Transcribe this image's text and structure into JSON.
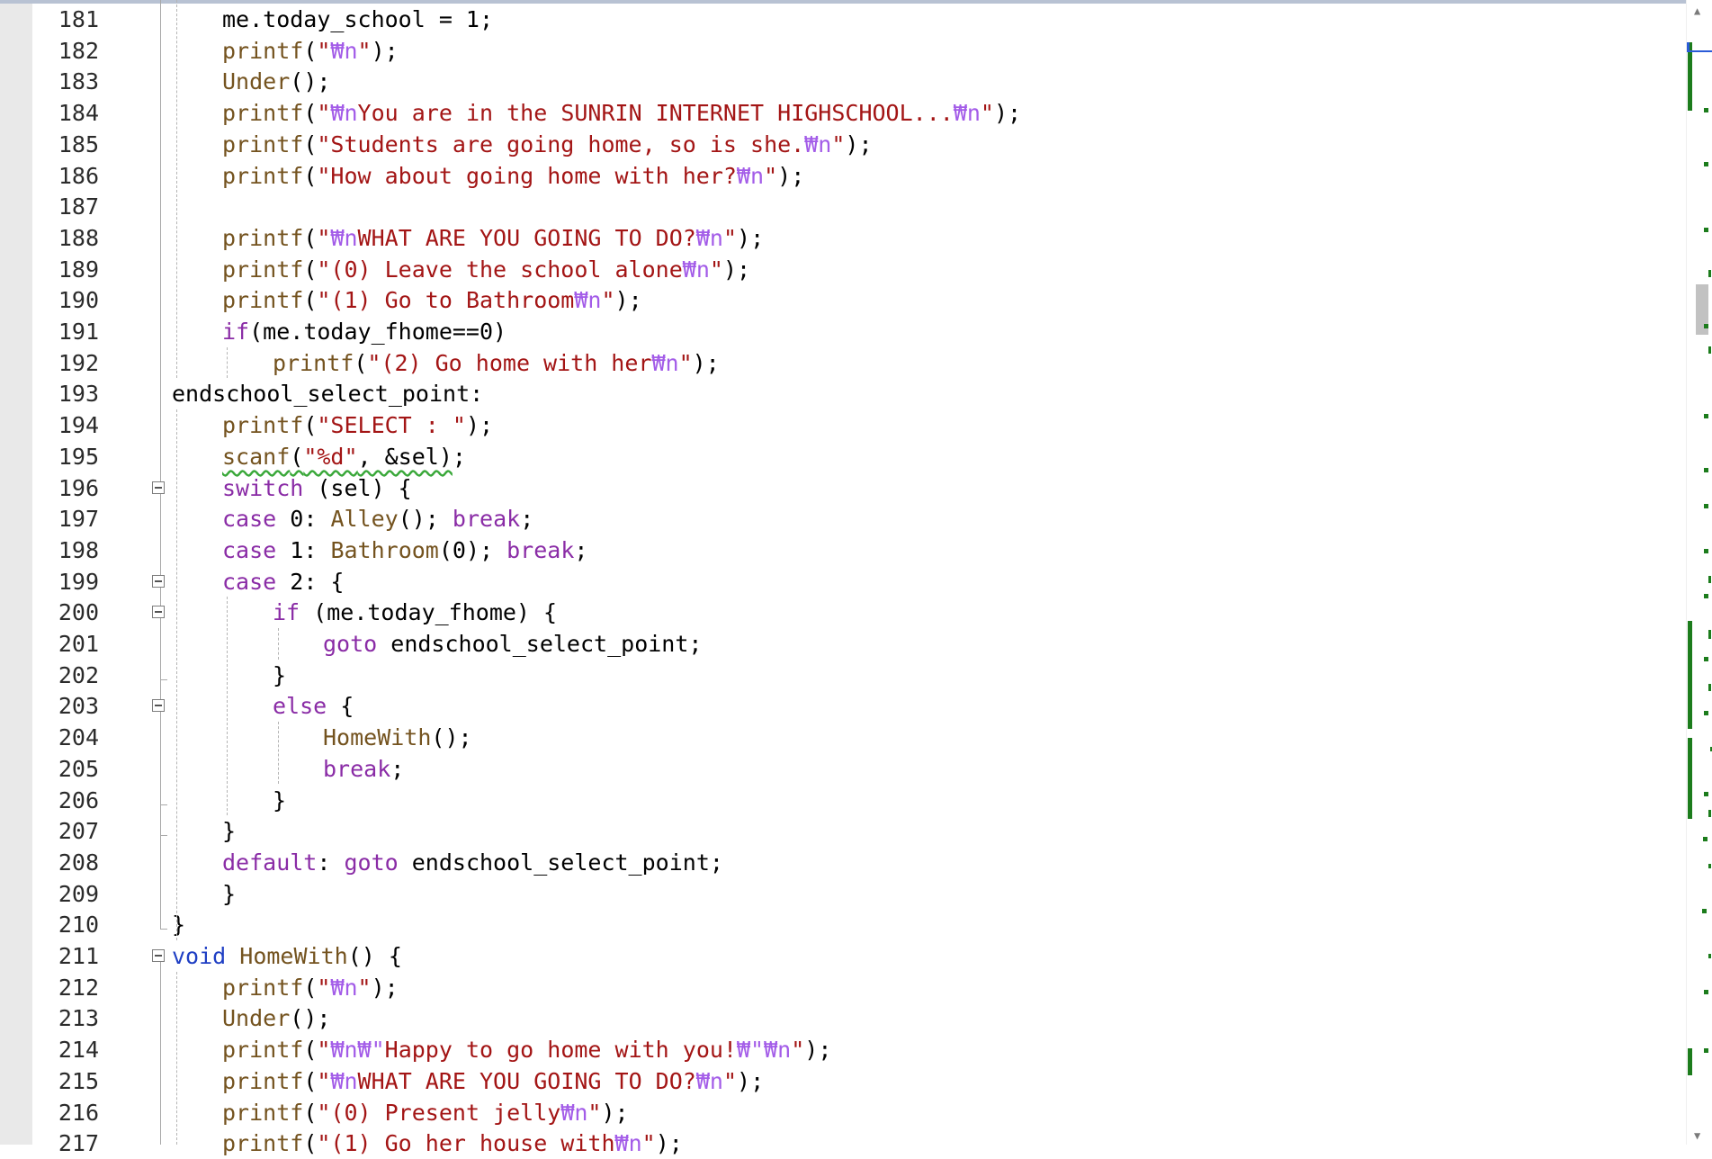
{
  "editor": {
    "lines": [
      {
        "n": "181",
        "indent": 1,
        "t": [
          [
            "",
            "me.today_school = 1;"
          ]
        ]
      },
      {
        "n": "182",
        "indent": 1,
        "t": [
          [
            "f",
            "printf"
          ],
          [
            "",
            "("
          ],
          [
            "s",
            "\""
          ],
          [
            "e",
            "₩n"
          ],
          [
            "s",
            "\""
          ],
          [
            "",
            ");"
          ]
        ]
      },
      {
        "n": "183",
        "indent": 1,
        "t": [
          [
            "f",
            "Under"
          ],
          [
            "",
            "();"
          ]
        ]
      },
      {
        "n": "184",
        "indent": 1,
        "t": [
          [
            "f",
            "printf"
          ],
          [
            "",
            "("
          ],
          [
            "s",
            "\""
          ],
          [
            "e",
            "₩n"
          ],
          [
            "s",
            "You are in the SUNRIN INTERNET HIGHSCHOOL..."
          ],
          [
            "e",
            "₩n"
          ],
          [
            "s",
            "\""
          ],
          [
            "",
            ");"
          ]
        ]
      },
      {
        "n": "185",
        "indent": 1,
        "t": [
          [
            "f",
            "printf"
          ],
          [
            "",
            "("
          ],
          [
            "s",
            "\"Students are going home, so is she."
          ],
          [
            "e",
            "₩n"
          ],
          [
            "s",
            "\""
          ],
          [
            "",
            ");"
          ]
        ]
      },
      {
        "n": "186",
        "indent": 1,
        "t": [
          [
            "f",
            "printf"
          ],
          [
            "",
            "("
          ],
          [
            "s",
            "\"How about going home with her?"
          ],
          [
            "e",
            "₩n"
          ],
          [
            "s",
            "\""
          ],
          [
            "",
            ");"
          ]
        ]
      },
      {
        "n": "187",
        "indent": 0,
        "t": []
      },
      {
        "n": "188",
        "indent": 1,
        "t": [
          [
            "f",
            "printf"
          ],
          [
            "",
            "("
          ],
          [
            "s",
            "\""
          ],
          [
            "e",
            "₩n"
          ],
          [
            "s",
            "WHAT ARE YOU GOING TO DO?"
          ],
          [
            "e",
            "₩n"
          ],
          [
            "s",
            "\""
          ],
          [
            "",
            ");"
          ]
        ]
      },
      {
        "n": "189",
        "indent": 1,
        "t": [
          [
            "f",
            "printf"
          ],
          [
            "",
            "("
          ],
          [
            "s",
            "\"(0) Leave the school alone"
          ],
          [
            "e",
            "₩n"
          ],
          [
            "s",
            "\""
          ],
          [
            "",
            ");"
          ]
        ]
      },
      {
        "n": "190",
        "indent": 1,
        "t": [
          [
            "f",
            "printf"
          ],
          [
            "",
            "("
          ],
          [
            "s",
            "\"(1) Go to Bathroom"
          ],
          [
            "e",
            "₩n"
          ],
          [
            "s",
            "\""
          ],
          [
            "",
            ");"
          ]
        ]
      },
      {
        "n": "191",
        "indent": 1,
        "t": [
          [
            "k",
            "if"
          ],
          [
            "",
            "(me.today_fhome==0)"
          ]
        ]
      },
      {
        "n": "192",
        "indent": 2,
        "t": [
          [
            "f",
            "printf"
          ],
          [
            "",
            "("
          ],
          [
            "s",
            "\"(2) Go home with her"
          ],
          [
            "e",
            "₩n"
          ],
          [
            "s",
            "\""
          ],
          [
            "",
            ");"
          ]
        ]
      },
      {
        "n": "193",
        "indent": 0,
        "t": [
          [
            "",
            "endschool_select_point:"
          ]
        ]
      },
      {
        "n": "194",
        "indent": 1,
        "t": [
          [
            "f",
            "printf"
          ],
          [
            "",
            "("
          ],
          [
            "s",
            "\"SELECT : \""
          ],
          [
            "",
            ");"
          ]
        ]
      },
      {
        "n": "195",
        "indent": 1,
        "t": [
          [
            "fq",
            "scanf"
          ],
          [
            "q",
            "("
          ],
          [
            "sq",
            "\"%d\""
          ],
          [
            "q",
            ", &sel)"
          ],
          [
            "",
            ";"
          ]
        ]
      },
      {
        "n": "196",
        "indent": 1,
        "t": [
          [
            "k",
            "switch"
          ],
          [
            "",
            " (sel) {"
          ]
        ]
      },
      {
        "n": "197",
        "indent": 1,
        "t": [
          [
            "k",
            "case"
          ],
          [
            "",
            " 0: "
          ],
          [
            "f",
            "Alley"
          ],
          [
            "",
            "(); "
          ],
          [
            "k",
            "break"
          ],
          [
            "",
            ";"
          ]
        ]
      },
      {
        "n": "198",
        "indent": 1,
        "t": [
          [
            "k",
            "case"
          ],
          [
            "",
            " 1: "
          ],
          [
            "f",
            "Bathroom"
          ],
          [
            "",
            "(0); "
          ],
          [
            "k",
            "break"
          ],
          [
            "",
            ";"
          ]
        ]
      },
      {
        "n": "199",
        "indent": 1,
        "t": [
          [
            "k",
            "case"
          ],
          [
            "",
            " 2: {"
          ]
        ]
      },
      {
        "n": "200",
        "indent": 2,
        "t": [
          [
            "k",
            "if"
          ],
          [
            "",
            " (me.today_fhome) {"
          ]
        ]
      },
      {
        "n": "201",
        "indent": 3,
        "t": [
          [
            "k",
            "goto"
          ],
          [
            "",
            " endschool_select_point;"
          ]
        ]
      },
      {
        "n": "202",
        "indent": 2,
        "t": [
          [
            "",
            "}"
          ]
        ]
      },
      {
        "n": "203",
        "indent": 2,
        "t": [
          [
            "k",
            "else"
          ],
          [
            "",
            " {"
          ]
        ]
      },
      {
        "n": "204",
        "indent": 3,
        "t": [
          [
            "f",
            "HomeWith"
          ],
          [
            "",
            "();"
          ]
        ]
      },
      {
        "n": "205",
        "indent": 3,
        "t": [
          [
            "k",
            "break"
          ],
          [
            "",
            ";"
          ]
        ]
      },
      {
        "n": "206",
        "indent": 2,
        "t": [
          [
            "",
            "}"
          ]
        ]
      },
      {
        "n": "207",
        "indent": 1,
        "t": [
          [
            "",
            "}"
          ]
        ]
      },
      {
        "n": "208",
        "indent": 1,
        "t": [
          [
            "k",
            "default"
          ],
          [
            "",
            ": "
          ],
          [
            "k",
            "goto"
          ],
          [
            "",
            " endschool_select_point;"
          ]
        ]
      },
      {
        "n": "209",
        "indent": 1,
        "t": [
          [
            "",
            "}"
          ]
        ]
      },
      {
        "n": "210",
        "indent": 0,
        "t": [
          [
            "",
            "}"
          ]
        ]
      },
      {
        "n": "211",
        "indent": 0,
        "t": [
          [
            "b",
            "void"
          ],
          [
            "",
            " "
          ],
          [
            "f",
            "HomeWith"
          ],
          [
            "",
            "() {"
          ]
        ]
      },
      {
        "n": "212",
        "indent": 1,
        "t": [
          [
            "f",
            "printf"
          ],
          [
            "",
            "("
          ],
          [
            "s",
            "\""
          ],
          [
            "e",
            "₩n"
          ],
          [
            "s",
            "\""
          ],
          [
            "",
            ");"
          ]
        ]
      },
      {
        "n": "213",
        "indent": 1,
        "t": [
          [
            "f",
            "Under"
          ],
          [
            "",
            "();"
          ]
        ]
      },
      {
        "n": "214",
        "indent": 1,
        "t": [
          [
            "f",
            "printf"
          ],
          [
            "",
            "("
          ],
          [
            "s",
            "\""
          ],
          [
            "e",
            "₩n₩\""
          ],
          [
            "s",
            "Happy to go home with you!"
          ],
          [
            "e",
            "₩\"₩n"
          ],
          [
            "s",
            "\""
          ],
          [
            "",
            ");"
          ]
        ]
      },
      {
        "n": "215",
        "indent": 1,
        "t": [
          [
            "f",
            "printf"
          ],
          [
            "",
            "("
          ],
          [
            "s",
            "\""
          ],
          [
            "e",
            "₩n"
          ],
          [
            "s",
            "WHAT ARE YOU GOING TO DO?"
          ],
          [
            "e",
            "₩n"
          ],
          [
            "s",
            "\""
          ],
          [
            "",
            ");"
          ]
        ]
      },
      {
        "n": "216",
        "indent": 1,
        "t": [
          [
            "f",
            "printf"
          ],
          [
            "",
            "("
          ],
          [
            "s",
            "\"(0) Present jelly"
          ],
          [
            "e",
            "₩n"
          ],
          [
            "s",
            "\""
          ],
          [
            "",
            ");"
          ]
        ]
      },
      {
        "n": "217",
        "indent": 1,
        "t": [
          [
            "f",
            "printf"
          ],
          [
            "",
            "("
          ],
          [
            "s",
            "\"(1) Go her house with"
          ],
          [
            "e",
            "₩n"
          ],
          [
            "s",
            "\""
          ],
          [
            "",
            ");"
          ]
        ]
      }
    ],
    "fold_lines": [
      "196",
      "199",
      "200",
      "203",
      "211"
    ]
  },
  "scrollbar": {
    "up_arrow": "▲",
    "down_arrow": "▼"
  }
}
